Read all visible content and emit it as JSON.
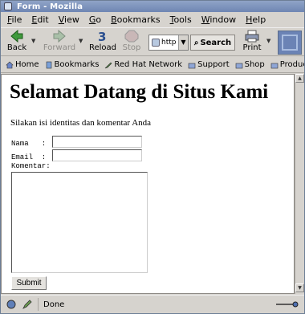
{
  "window": {
    "title": "Form - Mozilla"
  },
  "menu": {
    "items": [
      {
        "key": "F",
        "rest": "ile"
      },
      {
        "key": "E",
        "rest": "dit"
      },
      {
        "key": "V",
        "rest": "iew"
      },
      {
        "key": "G",
        "rest": "o"
      },
      {
        "key": "B",
        "rest": "ookmarks"
      },
      {
        "key": "T",
        "rest": "ools"
      },
      {
        "key": "W",
        "rest": "indow"
      },
      {
        "key": "H",
        "rest": "elp"
      }
    ]
  },
  "nav": {
    "back": "Back",
    "forward": "Forward",
    "reload": "Reload",
    "stop": "Stop",
    "url_value": "http",
    "search": "Search",
    "print": "Print"
  },
  "bookmarks": {
    "items": [
      "Home",
      "Bookmarks",
      "Red Hat Network",
      "Support",
      "Shop",
      "Products"
    ]
  },
  "page": {
    "heading": "Selamat Datang di Situs Kami",
    "intro": "Silakan isi identitas dan komentar Anda",
    "nama_label": "Nama   :",
    "email_label": "Email  :",
    "komentar_label": "Komentar:",
    "submit": "Submit"
  },
  "status": {
    "text": "Done"
  },
  "colors": {
    "chrome": "#d6d3ce",
    "titlebar": "#7b90bd",
    "content_bg": "#ffffff"
  }
}
